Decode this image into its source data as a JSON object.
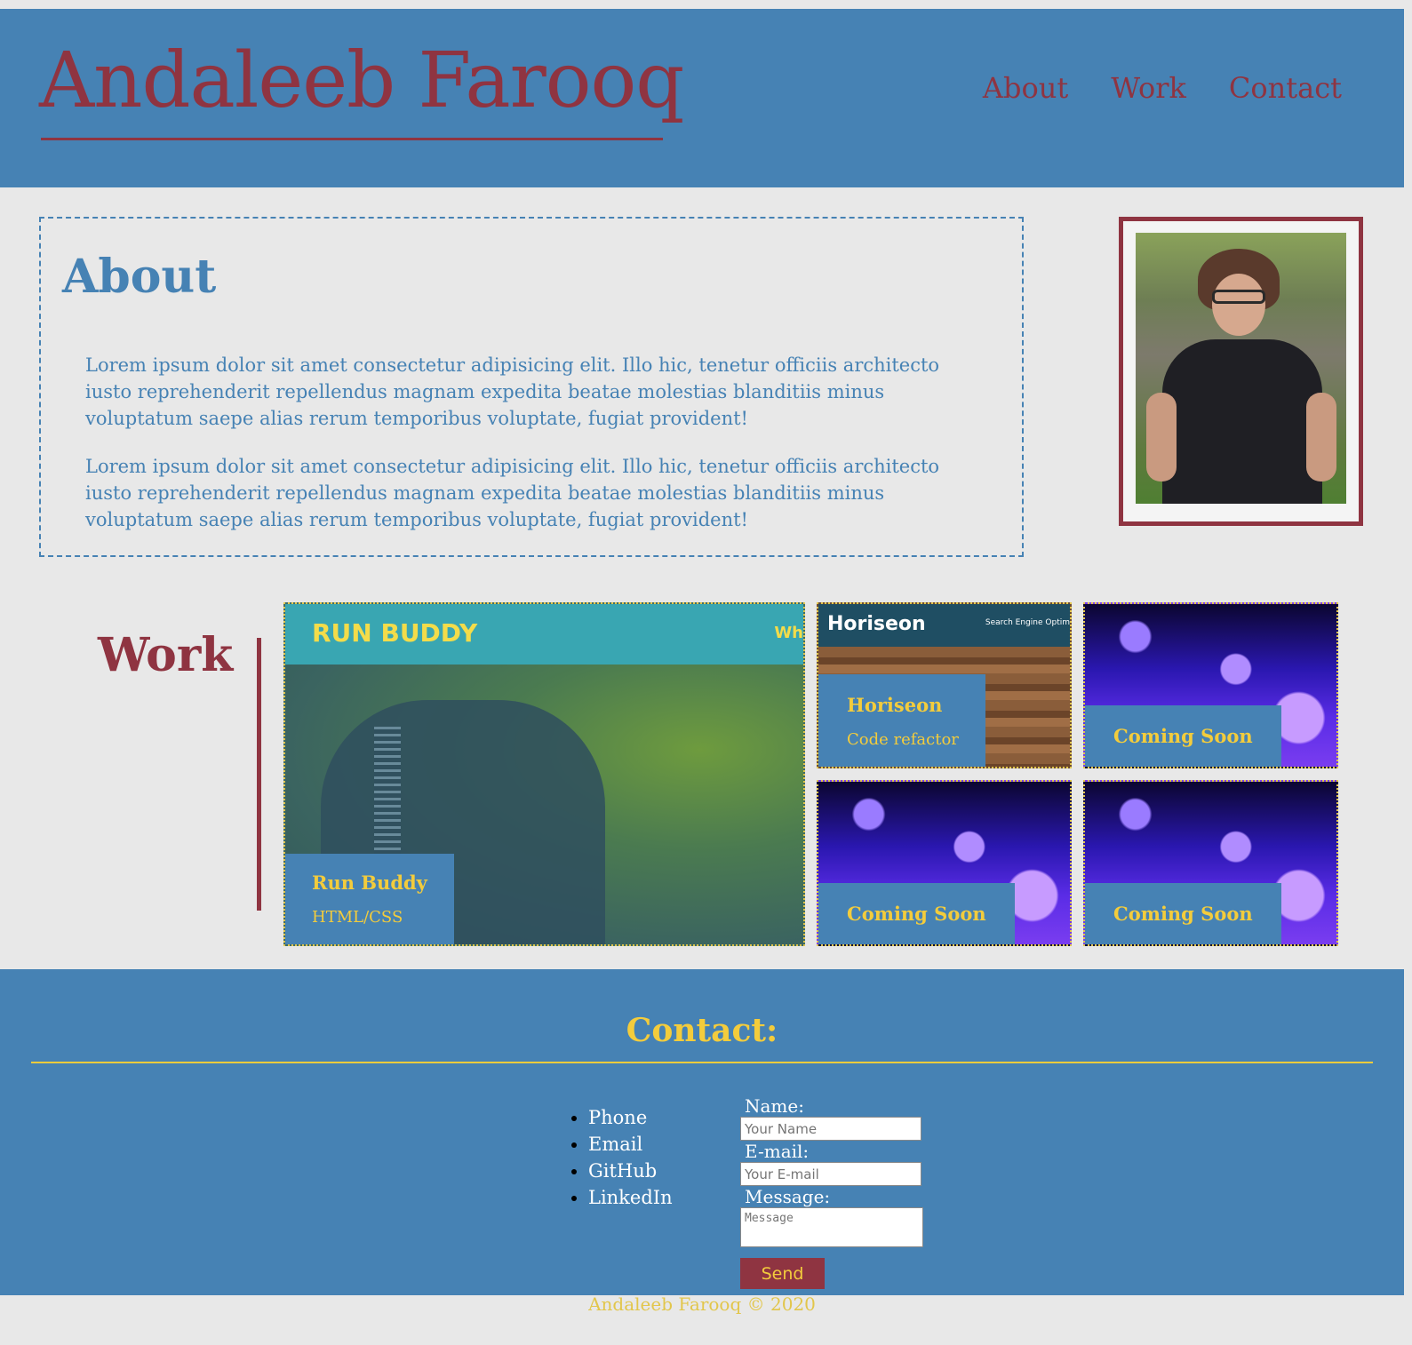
{
  "header": {
    "title": "Andaleeb Farooq",
    "nav": [
      "About",
      "Work",
      "Contact"
    ]
  },
  "about": {
    "heading": "About",
    "paragraphs": [
      "Lorem ipsum dolor sit amet consectetur adipisicing elit. Illo hic, tenetur officiis architecto iusto reprehenderit repellendus magnam expedita beatae molestias blanditiis minus voluptatum saepe alias rerum temporibus voluptate, fugiat provident!",
      "Lorem ipsum dolor sit amet consectetur adipisicing elit. Illo hic, tenetur officiis architecto iusto reprehenderit repellendus magnam expedita beatae molestias blanditiis minus voluptatum saepe alias rerum temporibus voluptate, fugiat provident!"
    ]
  },
  "work": {
    "heading": "Work",
    "projects": [
      {
        "title": "Run Buddy",
        "subtitle": "HTML/CSS",
        "screenshot_logo": "RUN BUDDY",
        "screenshot_nav": "Wh"
      },
      {
        "title": "Horiseon",
        "subtitle": "Code refactor",
        "screenshot_logo": "Horiseon",
        "screenshot_nav": "Search Engine Optim"
      },
      {
        "title": "Coming Soon"
      },
      {
        "title": "Coming Soon"
      },
      {
        "title": "Coming Soon"
      }
    ]
  },
  "contact": {
    "heading": "Contact:",
    "links": [
      "Phone",
      "Email",
      "GitHub",
      "LinkedIn"
    ],
    "form": {
      "name_label": "Name:",
      "name_placeholder": "Your Name",
      "email_label": "E-mail:",
      "email_placeholder": "Your E-mail",
      "message_label": "Message:",
      "message_placeholder": "Message",
      "send_label": "Send"
    }
  },
  "footer": {
    "text": "Andaleeb Farooq © 2020"
  },
  "colors": {
    "primary": "#4682b4",
    "accent": "#8f3441",
    "highlight": "#f3cc3c",
    "background": "#e8e8e8"
  }
}
